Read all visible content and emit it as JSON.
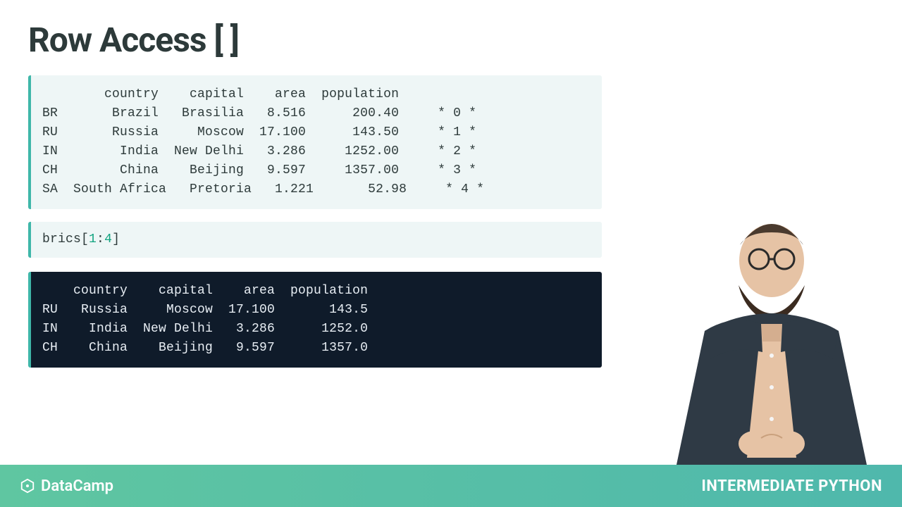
{
  "title": "Row Access [ ]",
  "output1": "        country    capital    area  population\nBR       Brazil   Brasilia   8.516      200.40     * 0 *\nRU       Russia     Moscow  17.100      143.50     * 1 *\nIN        India  New Delhi   3.286     1252.00     * 2 *\nCH        China    Beijing   9.597     1357.00     * 3 *\nSA  South Africa   Pretoria   1.221       52.98     * 4 *",
  "code": {
    "var": "brics",
    "lbrack": "[",
    "a": "1",
    "colon": ":",
    "b": "4",
    "rbrack": "]"
  },
  "output2": "    country    capital    area  population\nRU   Russia     Moscow  17.100       143.5\nIN    India  New Delhi   3.286      1252.0\nCH    China    Beijing   9.597      1357.0",
  "footer": {
    "brand": "DataCamp",
    "course": "INTERMEDIATE PYTHON"
  },
  "colors": {
    "accent": "#3fb7a9",
    "darkbg": "#0f1b2a",
    "lightbg": "#eef6f6",
    "footerStart": "#5fc6a1",
    "footerEnd": "#4fb8ac"
  }
}
